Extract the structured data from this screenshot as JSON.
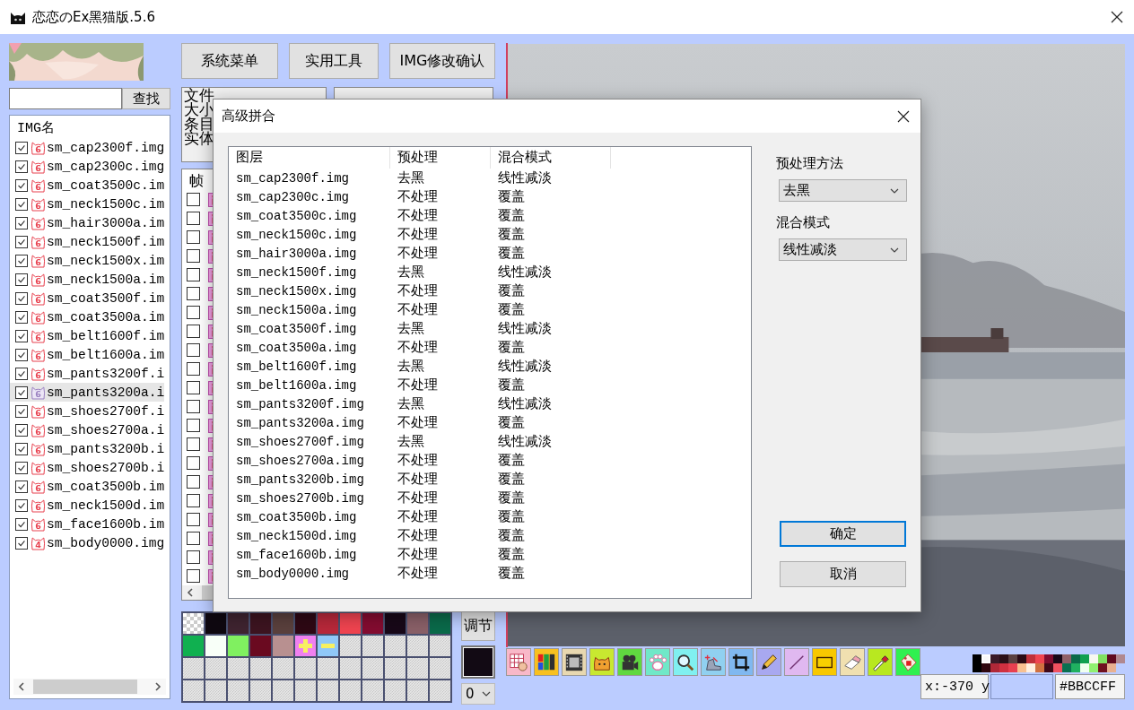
{
  "window": {
    "title": "恋恋のEx黑猫版.5.6"
  },
  "search": {
    "button": "查找"
  },
  "img_list": {
    "header": "IMG名",
    "items": [
      {
        "name": "sm_cap2300f.img",
        "badge": "6",
        "checked": true,
        "selected": false
      },
      {
        "name": "sm_cap2300c.img",
        "badge": "6",
        "checked": true,
        "selected": false
      },
      {
        "name": "sm_coat3500c.im",
        "badge": "6",
        "checked": true,
        "selected": false
      },
      {
        "name": "sm_neck1500c.im",
        "badge": "6",
        "checked": true,
        "selected": false
      },
      {
        "name": "sm_hair3000a.im",
        "badge": "6",
        "checked": true,
        "selected": false
      },
      {
        "name": "sm_neck1500f.im",
        "badge": "6",
        "checked": true,
        "selected": false
      },
      {
        "name": "sm_neck1500x.im",
        "badge": "6",
        "checked": true,
        "selected": false
      },
      {
        "name": "sm_neck1500a.im",
        "badge": "6",
        "checked": true,
        "selected": false
      },
      {
        "name": "sm_coat3500f.im",
        "badge": "6",
        "checked": true,
        "selected": false
      },
      {
        "name": "sm_coat3500a.im",
        "badge": "6",
        "checked": true,
        "selected": false
      },
      {
        "name": "sm_belt1600f.im",
        "badge": "6",
        "checked": true,
        "selected": false
      },
      {
        "name": "sm_belt1600a.im",
        "badge": "6",
        "checked": true,
        "selected": false
      },
      {
        "name": "sm_pants3200f.i",
        "badge": "6",
        "checked": true,
        "selected": false
      },
      {
        "name": "sm_pants3200a.i",
        "badge": "6",
        "checked": true,
        "selected": true
      },
      {
        "name": "sm_shoes2700f.i",
        "badge": "6",
        "checked": true,
        "selected": false
      },
      {
        "name": "sm_shoes2700a.i",
        "badge": "6",
        "checked": true,
        "selected": false
      },
      {
        "name": "sm_pants3200b.i",
        "badge": "6",
        "checked": true,
        "selected": false
      },
      {
        "name": "sm_shoes2700b.i",
        "badge": "6",
        "checked": true,
        "selected": false
      },
      {
        "name": "sm_coat3500b.im",
        "badge": "6",
        "checked": true,
        "selected": false
      },
      {
        "name": "sm_neck1500d.im",
        "badge": "6",
        "checked": true,
        "selected": false
      },
      {
        "name": "sm_face1600b.im",
        "badge": "6",
        "checked": true,
        "selected": false
      },
      {
        "name": "sm_body0000.img",
        "badge": "4",
        "checked": true,
        "selected": false
      }
    ]
  },
  "menu_buttons": [
    "系统菜单",
    "实用工具",
    "IMG修改确认"
  ],
  "file_info": {
    "lines": [
      "文件",
      "大小",
      "条目",
      "实体"
    ]
  },
  "frame_list": {
    "header": "帧",
    "rows": [
      {
        "checked": false
      },
      {
        "checked": false
      },
      {
        "checked": false
      },
      {
        "checked": false
      },
      {
        "checked": false
      },
      {
        "checked": false
      },
      {
        "checked": false
      },
      {
        "checked": false
      },
      {
        "checked": false
      },
      {
        "checked": false
      },
      {
        "checked": false
      },
      {
        "checked": false
      },
      {
        "checked": false
      },
      {
        "checked": false
      },
      {
        "checked": false
      },
      {
        "checked": false
      },
      {
        "checked": false
      },
      {
        "checked": false
      },
      {
        "checked": false
      },
      {
        "checked": false
      },
      {
        "checked": false
      }
    ]
  },
  "palette": [
    {
      "kind": "transparent"
    },
    {
      "kind": "color",
      "color": "#0f0810"
    },
    {
      "kind": "color",
      "color": "#3f2430"
    },
    {
      "kind": "color",
      "color": "#3d1420"
    },
    {
      "kind": "color",
      "color": "#5a403d"
    },
    {
      "kind": "color",
      "color": "#2e0814"
    },
    {
      "kind": "color",
      "color": "#b8283a"
    },
    {
      "kind": "color",
      "color": "#f04450"
    },
    {
      "kind": "color",
      "color": "#840c30"
    },
    {
      "kind": "color",
      "color": "#180818"
    },
    {
      "kind": "color",
      "color": "#8a6068"
    },
    {
      "kind": "color",
      "color": "#0a6a4a"
    },
    {
      "kind": "color",
      "color": "#10b050"
    },
    {
      "kind": "color",
      "color": "#f8fff8"
    },
    {
      "kind": "color",
      "color": "#80f060"
    },
    {
      "kind": "color",
      "color": "#6a0a20"
    },
    {
      "kind": "color",
      "color": "#b89090"
    },
    {
      "kind": "add"
    },
    {
      "kind": "remove"
    },
    {
      "kind": "empty"
    },
    {
      "kind": "empty"
    },
    {
      "kind": "empty"
    },
    {
      "kind": "empty"
    },
    {
      "kind": "empty"
    },
    {
      "kind": "empty"
    },
    {
      "kind": "empty"
    },
    {
      "kind": "empty"
    },
    {
      "kind": "empty"
    },
    {
      "kind": "empty"
    },
    {
      "kind": "empty"
    },
    {
      "kind": "empty"
    },
    {
      "kind": "empty"
    },
    {
      "kind": "empty"
    },
    {
      "kind": "empty"
    },
    {
      "kind": "empty"
    },
    {
      "kind": "empty"
    },
    {
      "kind": "empty"
    },
    {
      "kind": "empty"
    },
    {
      "kind": "empty"
    },
    {
      "kind": "empty"
    },
    {
      "kind": "empty"
    },
    {
      "kind": "empty"
    },
    {
      "kind": "empty"
    },
    {
      "kind": "empty"
    },
    {
      "kind": "empty"
    },
    {
      "kind": "empty"
    },
    {
      "kind": "empty"
    },
    {
      "kind": "empty"
    }
  ],
  "adjust_button": "调节",
  "current_color": {
    "color": "#120a14"
  },
  "layer_select": {
    "value": "0"
  },
  "toolbar": [
    {
      "kind": "table",
      "color": "#f8b8c8"
    },
    {
      "kind": "bars",
      "color": "#f8c020"
    },
    {
      "kind": "film",
      "color": "#e8d8b0"
    },
    {
      "kind": "cat",
      "color": "#c8e830"
    },
    {
      "kind": "camera",
      "color": "#60d840"
    },
    {
      "kind": "paw",
      "color": "#70e8c8"
    },
    {
      "kind": "search",
      "color": "#80f0f0"
    },
    {
      "kind": "transform",
      "color": "#90d0f0"
    },
    {
      "kind": "crop",
      "color": "#80b8f0"
    },
    {
      "kind": "pencil",
      "color": "#a8a8f0"
    },
    {
      "kind": "line",
      "color": "#e0b8f0"
    },
    {
      "kind": "rect",
      "color": "#f8c800"
    },
    {
      "kind": "eraser",
      "color": "#f0e0b0"
    },
    {
      "kind": "picker",
      "color": "#b8e820"
    },
    {
      "kind": "tag",
      "color": "#30f050"
    }
  ],
  "coords": {
    "value": "x:-370 y"
  },
  "preview_color": {
    "color": "#bbccff"
  },
  "hex_field": {
    "value": "#BBCCFF"
  },
  "dialog": {
    "title": "高级拼合",
    "columns": [
      "图层",
      "预处理",
      "混合模式"
    ],
    "rows": [
      {
        "layer": "sm_cap2300f.img",
        "preprocess": "去黑",
        "blend": "线性减淡"
      },
      {
        "layer": "sm_cap2300c.img",
        "preprocess": "不处理",
        "blend": "覆盖"
      },
      {
        "layer": "sm_coat3500c.img",
        "preprocess": "不处理",
        "blend": "覆盖"
      },
      {
        "layer": "sm_neck1500c.img",
        "preprocess": "不处理",
        "blend": "覆盖"
      },
      {
        "layer": "sm_hair3000a.img",
        "preprocess": "不处理",
        "blend": "覆盖"
      },
      {
        "layer": "sm_neck1500f.img",
        "preprocess": "去黑",
        "blend": "线性减淡"
      },
      {
        "layer": "sm_neck1500x.img",
        "preprocess": "不处理",
        "blend": "覆盖"
      },
      {
        "layer": "sm_neck1500a.img",
        "preprocess": "不处理",
        "blend": "覆盖"
      },
      {
        "layer": "sm_coat3500f.img",
        "preprocess": "去黑",
        "blend": "线性减淡"
      },
      {
        "layer": "sm_coat3500a.img",
        "preprocess": "不处理",
        "blend": "覆盖"
      },
      {
        "layer": "sm_belt1600f.img",
        "preprocess": "去黑",
        "blend": "线性减淡"
      },
      {
        "layer": "sm_belt1600a.img",
        "preprocess": "不处理",
        "blend": "覆盖"
      },
      {
        "layer": "sm_pants3200f.img",
        "preprocess": "去黑",
        "blend": "线性减淡"
      },
      {
        "layer": "sm_pants3200a.img",
        "preprocess": "不处理",
        "blend": "覆盖"
      },
      {
        "layer": "sm_shoes2700f.img",
        "preprocess": "去黑",
        "blend": "线性减淡"
      },
      {
        "layer": "sm_shoes2700a.img",
        "preprocess": "不处理",
        "blend": "覆盖"
      },
      {
        "layer": "sm_pants3200b.img",
        "preprocess": "不处理",
        "blend": "覆盖"
      },
      {
        "layer": "sm_shoes2700b.img",
        "preprocess": "不处理",
        "blend": "覆盖"
      },
      {
        "layer": "sm_coat3500b.img",
        "preprocess": "不处理",
        "blend": "覆盖"
      },
      {
        "layer": "sm_neck1500d.img",
        "preprocess": "不处理",
        "blend": "覆盖"
      },
      {
        "layer": "sm_face1600b.img",
        "preprocess": "不处理",
        "blend": "覆盖"
      },
      {
        "layer": "sm_body0000.img",
        "preprocess": "不处理",
        "blend": "覆盖"
      }
    ],
    "preprocess_label": "预处理方法",
    "preprocess_value": "去黑",
    "blend_label": "混合模式",
    "blend_value": "线性减淡",
    "buttons": [
      {
        "label": "确定",
        "default": true
      },
      {
        "label": "取消",
        "default": false
      }
    ]
  }
}
